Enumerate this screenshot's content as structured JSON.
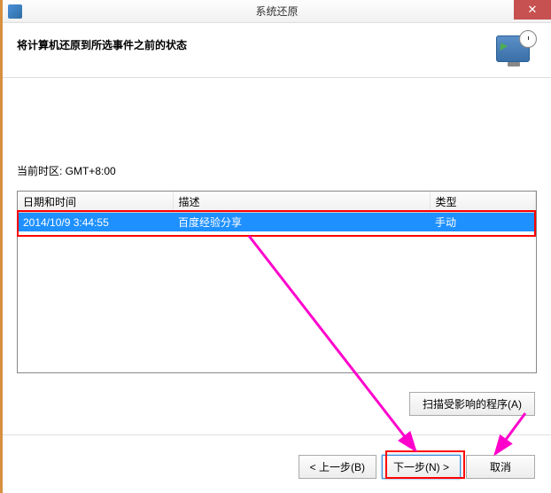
{
  "titlebar": {
    "title": "系统还原",
    "close": "✕"
  },
  "header": {
    "heading": "将计算机还原到所选事件之前的状态"
  },
  "timezone": {
    "label": "当前时区: GMT+8:00"
  },
  "table": {
    "columns": {
      "date": "日期和时间",
      "desc": "描述",
      "type": "类型"
    },
    "rows": [
      {
        "date": "2014/10/9 3:44:55",
        "desc": "百度经验分享",
        "type": "手动"
      }
    ]
  },
  "buttons": {
    "scan": "扫描受影响的程序(A)",
    "back": "< 上一步(B)",
    "next": "下一步(N) >",
    "cancel": "取消"
  }
}
